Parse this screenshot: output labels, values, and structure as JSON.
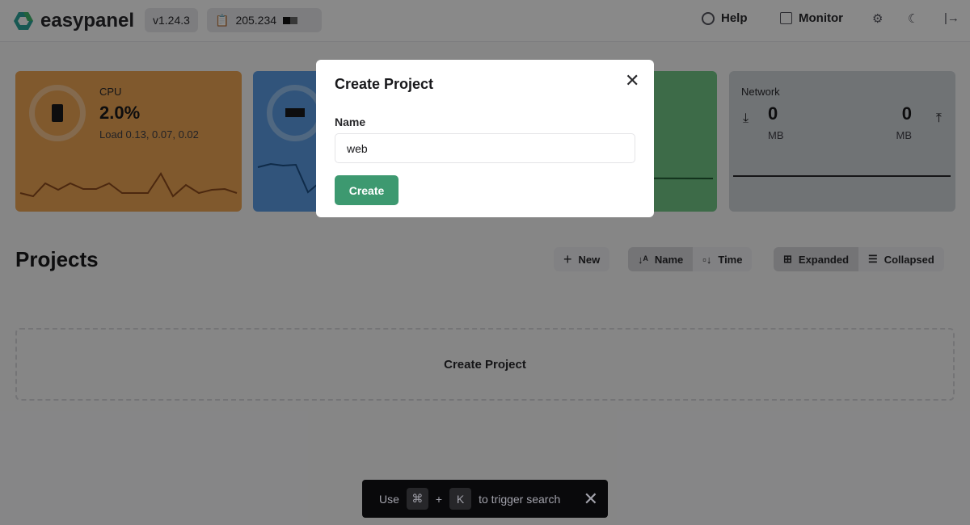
{
  "header": {
    "brand": "easypanel",
    "version": "v1.24.3",
    "ip": "205.234",
    "help": "Help",
    "monitor": "Monitor"
  },
  "stats": {
    "cpu": {
      "label": "CPU",
      "value": "2.0%",
      "load": "Load 0.13, 0.07, 0.02",
      "usage_percent": 2,
      "color": "#e9a253"
    },
    "memory": {
      "color": "#5a9ae0"
    },
    "disk": {
      "color": "#6fc383"
    },
    "network": {
      "label": "Network",
      "download": "0",
      "download_unit": "MB",
      "upload": "0",
      "upload_unit": "MB",
      "color": "#cdd1d6"
    }
  },
  "projects": {
    "title": "Projects",
    "new": "New",
    "sort_name": "Name",
    "sort_time": "Time",
    "view_expanded": "Expanded",
    "view_collapsed": "Collapsed",
    "empty_action": "Create Project"
  },
  "toast": {
    "use": "Use",
    "cmd": "⌘",
    "plus": "+",
    "key": "K",
    "text": "to trigger search"
  },
  "modal": {
    "title": "Create Project",
    "name_label": "Name",
    "name_value": "web",
    "submit": "Create"
  }
}
